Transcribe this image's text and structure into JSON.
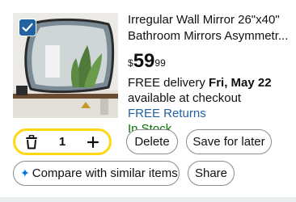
{
  "product": {
    "title": "Irregular Wall Mirror 26\"x40\" Bathroom Mirrors Asymmetr...",
    "price_symbol": "$",
    "price_whole": "59",
    "price_fraction": "99",
    "delivery_prefix": "FREE delivery ",
    "delivery_date": "Fri, May 22",
    "availability": "available at checkout",
    "returns": "FREE Returns",
    "stock": "In Stock",
    "selected": true,
    "image_icon": "irregular-mirror-photo"
  },
  "cart_controls": {
    "quantity": "1",
    "delete_icon": "trash-icon",
    "increase_icon": "plus-icon"
  },
  "actions": {
    "delete_label": "Delete",
    "save_label": "Save for later",
    "compare_label": "Compare with similar items",
    "share_label": "Share"
  },
  "colors": {
    "accent_yellow": "#ffd814",
    "link_blue": "#2162a1",
    "stock_green": "#007600",
    "checkbox_blue": "#2162a1"
  }
}
